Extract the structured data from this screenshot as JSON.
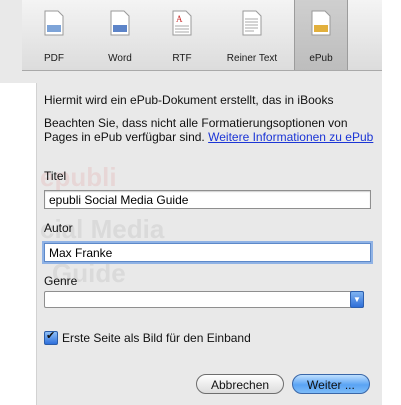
{
  "toolbar": {
    "tabs": [
      {
        "label": "PDF",
        "icon": "pdf-icon"
      },
      {
        "label": "Word",
        "icon": "word-doc-icon"
      },
      {
        "label": "RTF",
        "icon": "rtf-doc-icon"
      },
      {
        "label": "Reiner Text",
        "icon": "text-doc-icon"
      },
      {
        "label": "ePub",
        "icon": "epub-icon"
      }
    ],
    "selected": "ePub"
  },
  "content": {
    "intro": "Hiermit wird ein ePub-Dokument erstellt, das in iBooks",
    "notice": "Beachten Sie, dass nicht alle Formatierungsoptionen von Pages in ePub verfügbar sind.",
    "notice_link": "Weitere Informationen zu ePub",
    "title_label": "Titel",
    "title_value": "epubli Social Media Guide",
    "author_label": "Autor",
    "author_value": "Max Franke",
    "genre_label": "Genre",
    "genre_value": "",
    "cover_checkbox_label": "Erste Seite als Bild für den Einband",
    "cover_checked": true
  },
  "buttons": {
    "cancel": "Abbrechen",
    "next": "Weiter ..."
  },
  "colors": {
    "link": "#1b35d6",
    "accent": "#5aa3f4"
  }
}
